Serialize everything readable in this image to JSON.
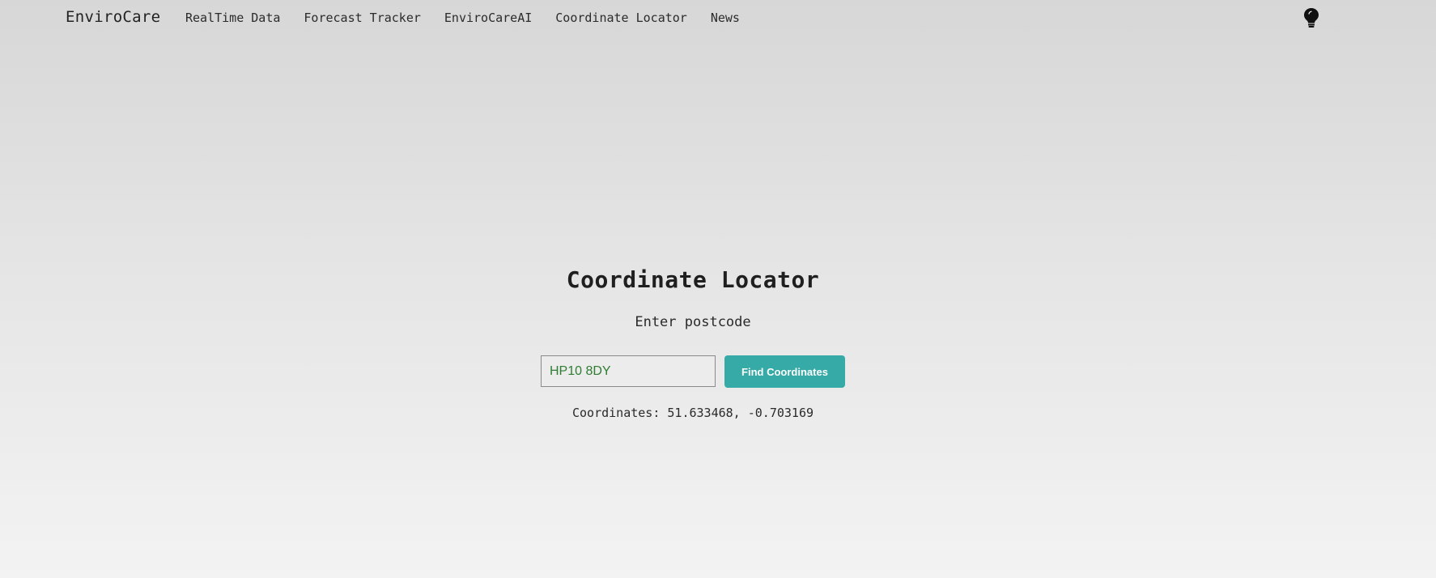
{
  "navbar": {
    "brand": "EnviroCare",
    "links": [
      {
        "label": "RealTime Data"
      },
      {
        "label": "Forecast Tracker"
      },
      {
        "label": "EnviroCareAI"
      },
      {
        "label": "Coordinate Locator"
      },
      {
        "label": "News"
      }
    ],
    "theme_toggle_icon": "lightbulb-icon"
  },
  "main": {
    "title": "Coordinate Locator",
    "subtitle": "Enter postcode",
    "postcode_value": "HP10 8DY",
    "button_label": "Find Coordinates",
    "result_text": "Coordinates: 51.633468, -0.703169"
  },
  "colors": {
    "accent": "#35aaa6",
    "input_text": "#2e7d32"
  }
}
